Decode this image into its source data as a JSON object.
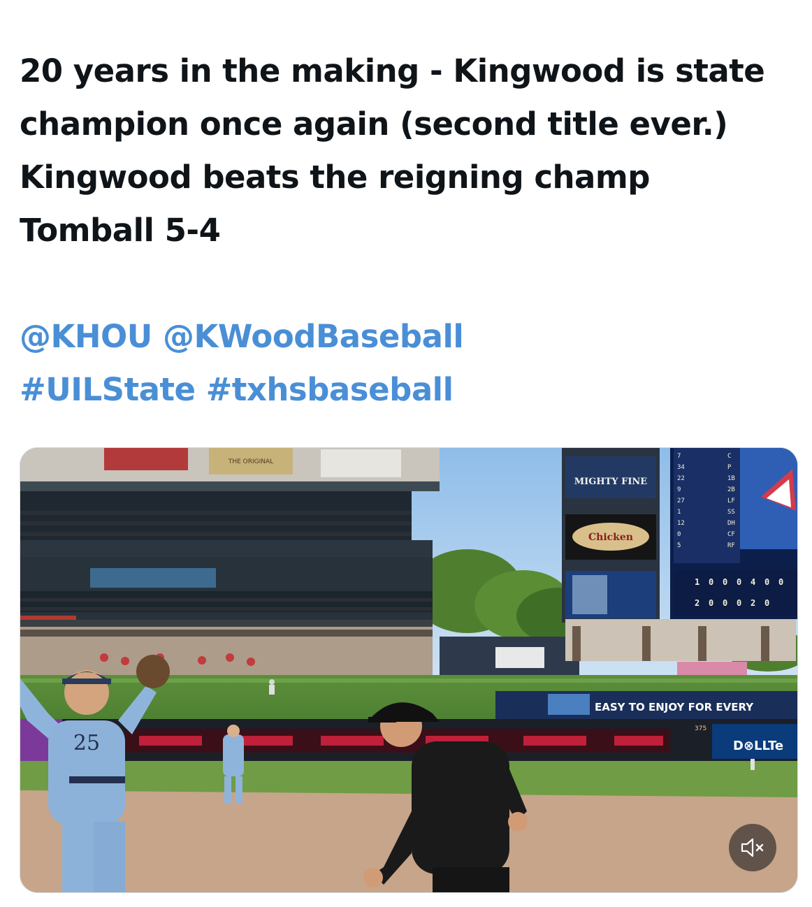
{
  "tweet": {
    "lines": [
      "20 years in the making - Kingwood is state",
      "champion once again (second title ever.)",
      "Kingwood beats the reigning champ",
      "Tomball 5-4"
    ],
    "mentions": [
      "@KHOU",
      "@KWoodBaseball"
    ],
    "hashtags": [
      "#UILState",
      "#txhsbaseball"
    ],
    "link_color": "#4a8fd6",
    "text_color": "#0f1419"
  },
  "video": {
    "scene_text": {
      "jersey_number": "25",
      "sign_mighty": "MIGHTY FINE",
      "sign_chicken": "Chicken",
      "sign_original": "THE ORIGINAL",
      "banner_easy": "EASY TO ENJOY FOR EVERY",
      "banner_dell": "D⊗LLTe",
      "distance_marker": "375"
    },
    "scoreboard": {
      "lineup_numbers": [
        "7",
        "34",
        "22",
        "9",
        "27",
        "1",
        "12",
        "0",
        "5"
      ],
      "positions": [
        "C",
        "P",
        "1B",
        "2B",
        "LF",
        "SS",
        "DH",
        "CF",
        "RF"
      ],
      "line_away": [
        "1",
        "0",
        "0",
        "0",
        "4",
        "0",
        "0"
      ],
      "line_home": [
        "2",
        "0",
        "0",
        "0",
        "2",
        "0"
      ]
    },
    "mute_icon": "speaker-muted-icon"
  }
}
